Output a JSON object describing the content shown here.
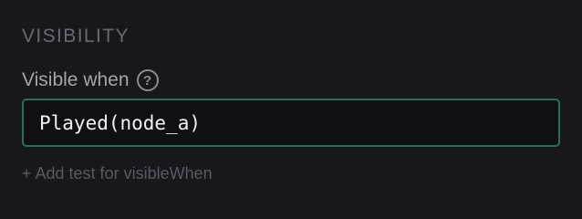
{
  "section": {
    "title": "VISIBILITY"
  },
  "field": {
    "label": "Visible when",
    "help_icon_glyph": "?",
    "help_icon_name": "help-circle-icon",
    "value": "Played(node_a)",
    "border_color": "#2a6d5c"
  },
  "actions": {
    "add_test_label": "+ Add test for visibleWhen"
  }
}
